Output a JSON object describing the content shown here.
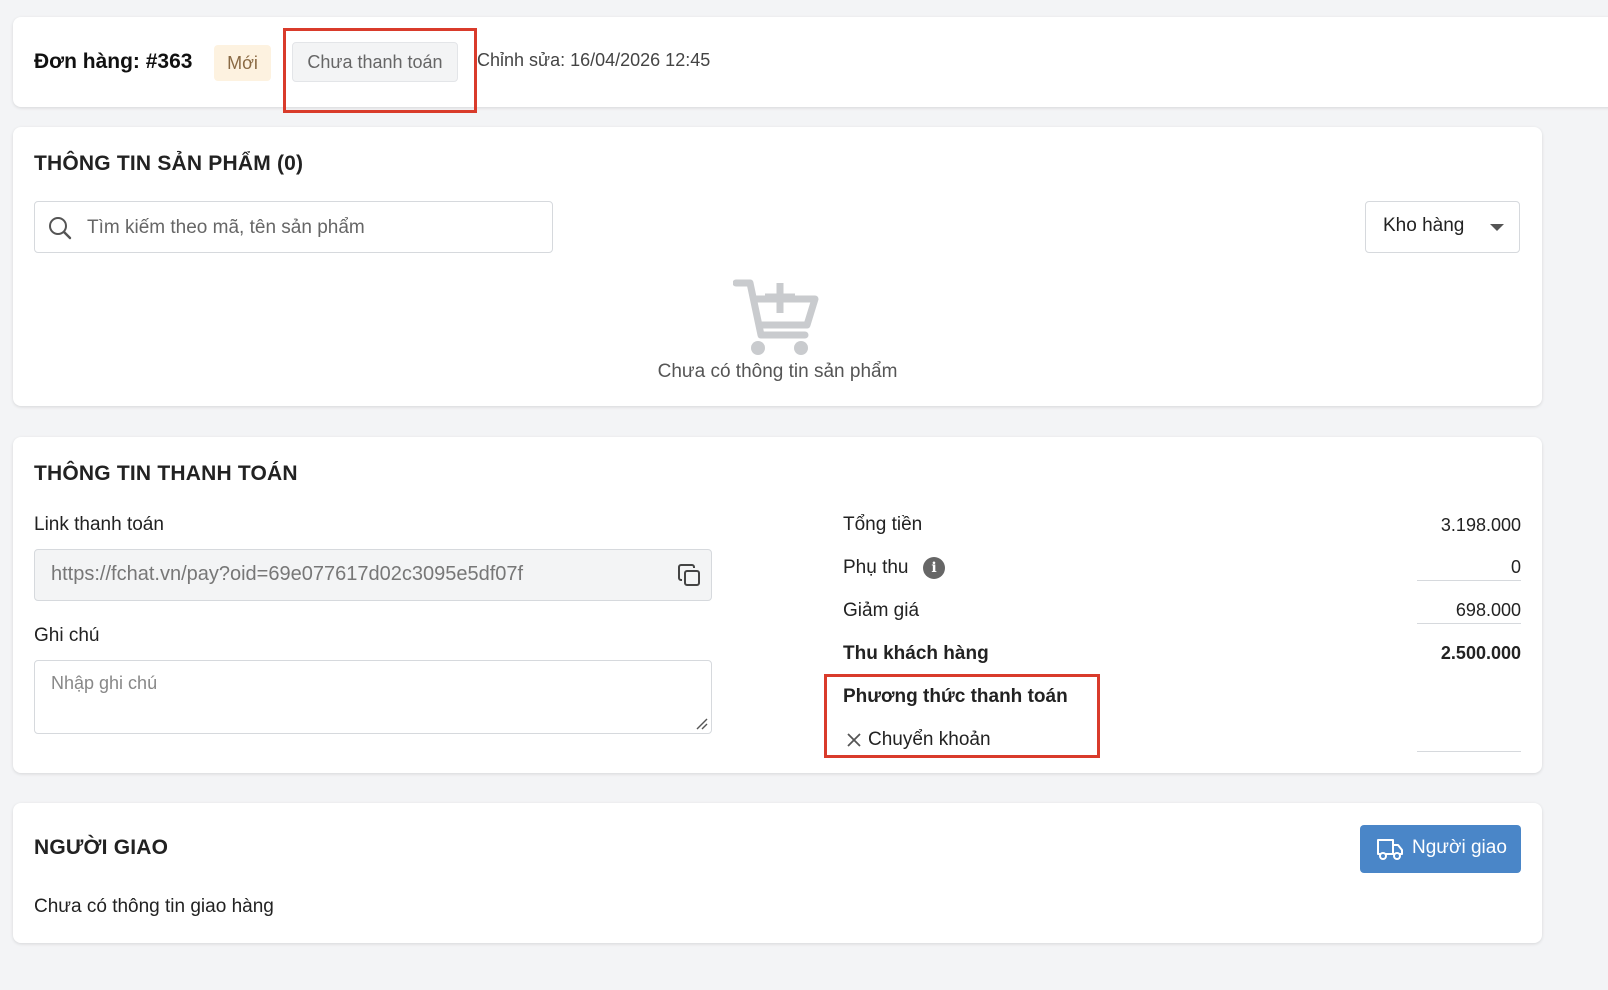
{
  "header": {
    "order_title": "Đơn hàng: #363",
    "badge_new": "Mới",
    "badge_unpaid": "Chưa thanh toán",
    "edit_time": "Chỉnh sửa: 16/04/2026 12:45"
  },
  "products": {
    "title": "THÔNG TIN SẢN PHẨM (0)",
    "search_placeholder": "Tìm kiếm theo mã, tên sản phẩm",
    "warehouse_label": "Kho hàng",
    "empty_text": "Chưa có thông tin sản phẩm",
    "icons": {
      "search": "search-icon",
      "dropdown": "caret-down-icon",
      "empty": "cart-plus-icon"
    }
  },
  "payment": {
    "title": "THÔNG TIN THANH TOÁN",
    "link_label": "Link thanh toán",
    "link_value": "https://fchat.vn/pay?oid=69e077617d02c3095e5df07f",
    "note_label": "Ghi chú",
    "note_placeholder": "Nhập ghi chú",
    "total_label": "Tổng tiền",
    "total_value": "3.198.000",
    "surcharge_label": "Phụ thu",
    "surcharge_value": "0",
    "discount_label": "Giảm giá",
    "discount_value": "698.000",
    "collect_label": "Thu khách hàng",
    "collect_value": "2.500.000",
    "method_label": "Phương thức thanh toán",
    "method_value": "Chuyển khoản",
    "icons": {
      "copy": "copy-icon",
      "info": "info-icon",
      "remove": "close-icon"
    }
  },
  "delivery": {
    "title": "NGƯỜI GIAO",
    "empty_text": "Chưa có thông tin giao hàng",
    "button_label": "Người giao",
    "icons": {
      "button": "truck-icon"
    }
  },
  "colors": {
    "highlight": "#d93b2b",
    "primary": "#4a86c8",
    "badge_new_bg": "#fdf2e0"
  }
}
